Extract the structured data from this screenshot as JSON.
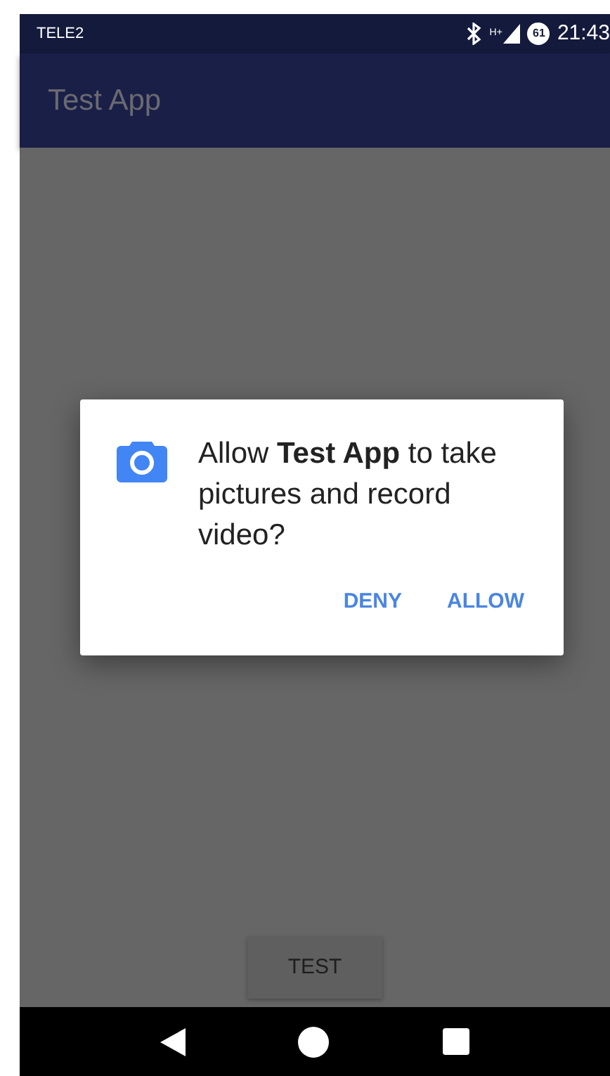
{
  "status_bar": {
    "carrier": "TELE2",
    "network_type": "H+",
    "battery": "61",
    "time": "21:43"
  },
  "app_bar": {
    "title": "Test App"
  },
  "dialog": {
    "message": "Allow **Test App** to take pictures and record video?",
    "buttons": [
      "DENY",
      "ALLOW"
    ]
  },
  "content": {
    "button": "TEST"
  }
}
